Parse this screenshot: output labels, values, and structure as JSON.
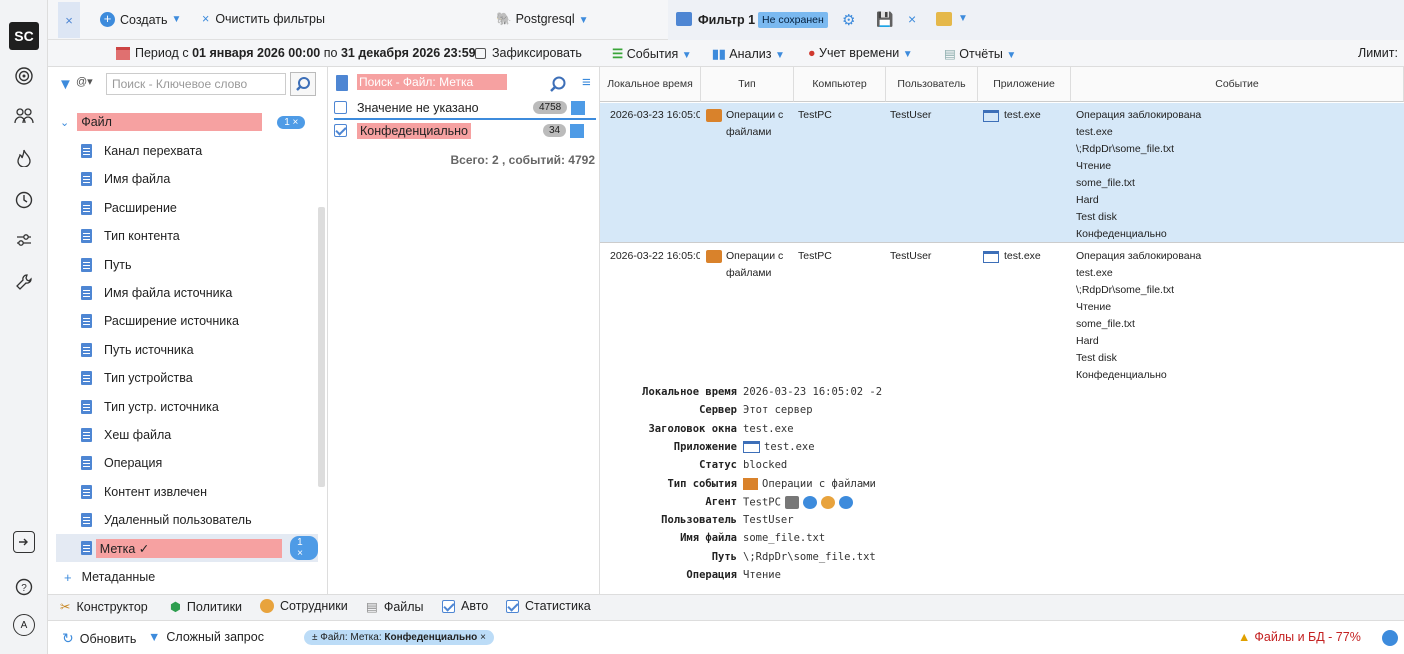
{
  "rail": {
    "logo": "SC",
    "bottom_avatar": "A"
  },
  "toolbar": {
    "create": "Создать",
    "clear": "Очистить фильтры",
    "db": "Postgresql",
    "filter_title": "Фильтр 1",
    "filter_state": "Не сохранен"
  },
  "toolbar2": {
    "period_prefix": "Период с",
    "period_from": "01 января 2026 00:00",
    "period_mid": "по",
    "period_to": "31 декабря 2026 23:59",
    "fix": "Зафиксировать",
    "events": "События",
    "analysis": "Анализ",
    "time": "Учет времени",
    "reports": "Отчёты",
    "limit": "Лимит:"
  },
  "left": {
    "search_placeholder": "Поиск - Ключевое слово",
    "group": {
      "label": "Файл",
      "badge": "1 ×"
    },
    "items": [
      "Канал перехвата",
      "Имя файла",
      "Расширение",
      "Тип контента",
      "Путь",
      "Имя файла источника",
      "Расширение источника",
      "Путь источника",
      "Тип устройства",
      "Тип устр. источника",
      "Хеш файла",
      "Операция",
      "Контент извлечен",
      "Удаленный пользователь"
    ],
    "tag": {
      "label": "Метка ✓",
      "badge": "1 ×"
    },
    "meta": "Метаданные"
  },
  "middle": {
    "search_placeholder": "Поиск - Файл: Метка",
    "values": [
      {
        "label": "Значение не указано",
        "count": "4758",
        "checked": false
      },
      {
        "label": "Конфеденциально",
        "count": "34",
        "checked": true
      }
    ],
    "total": "Всего: 2 , событий: 4792"
  },
  "grid": {
    "headers": [
      "Локальное время",
      "Тип",
      "Компьютер",
      "Пользователь",
      "Приложение",
      "Событие"
    ],
    "rows": [
      {
        "time": "2026-03-23 16:05:0",
        "type": "Операции с файлами",
        "computer": "TestPC",
        "user": "TestUser",
        "app": "test.exe",
        "event": [
          "Операция заблокирована",
          "test.exe",
          "\\;RdpDr\\some_file.txt",
          "Чтение",
          "some_file.txt",
          "Hard",
          "Test disk",
          "Конфеденциально"
        ]
      },
      {
        "time": "2026-03-22 16:05:0",
        "type": "Операции с файлами",
        "computer": "TestPC",
        "user": "TestUser",
        "app": "test.exe",
        "event": [
          "Операция заблокирована",
          "test.exe",
          "\\;RdpDr\\some_file.txt",
          "Чтение",
          "some_file.txt",
          "Hard",
          "Test disk",
          "Конфеденциально"
        ]
      }
    ]
  },
  "detail": [
    {
      "label": "Локальное время",
      "value": "2026-03-23 16:05:02 -2"
    },
    {
      "label": "Сервер",
      "value": "Этот сервер"
    },
    {
      "label": "Заголовок окна",
      "value": "test.exe"
    },
    {
      "label": "Приложение",
      "value": "test.exe"
    },
    {
      "label": "Статус",
      "value": "blocked"
    },
    {
      "label": "Тип события",
      "value": "Операции с файлами"
    },
    {
      "label": "Агент",
      "value": "TestPC"
    },
    {
      "label": "Пользователь",
      "value": "TestUser"
    },
    {
      "label": "Имя файла",
      "value": "some_file.txt"
    },
    {
      "label": "Путь",
      "value": "\\;RdpDr\\some_file.txt"
    },
    {
      "label": "Операция",
      "value": "Чтение"
    }
  ],
  "tabs": [
    "Конструктор",
    "Политики",
    "Сотрудники",
    "Файлы",
    "Авто",
    "Статистика"
  ],
  "status": {
    "refresh": "Обновить",
    "complex": "Сложный запрос",
    "chip_prefix": "± Файл: Метка:",
    "chip_value": "Конфеденциально",
    "chip_close": "×",
    "warn": "Файлы и БД - 77%"
  }
}
